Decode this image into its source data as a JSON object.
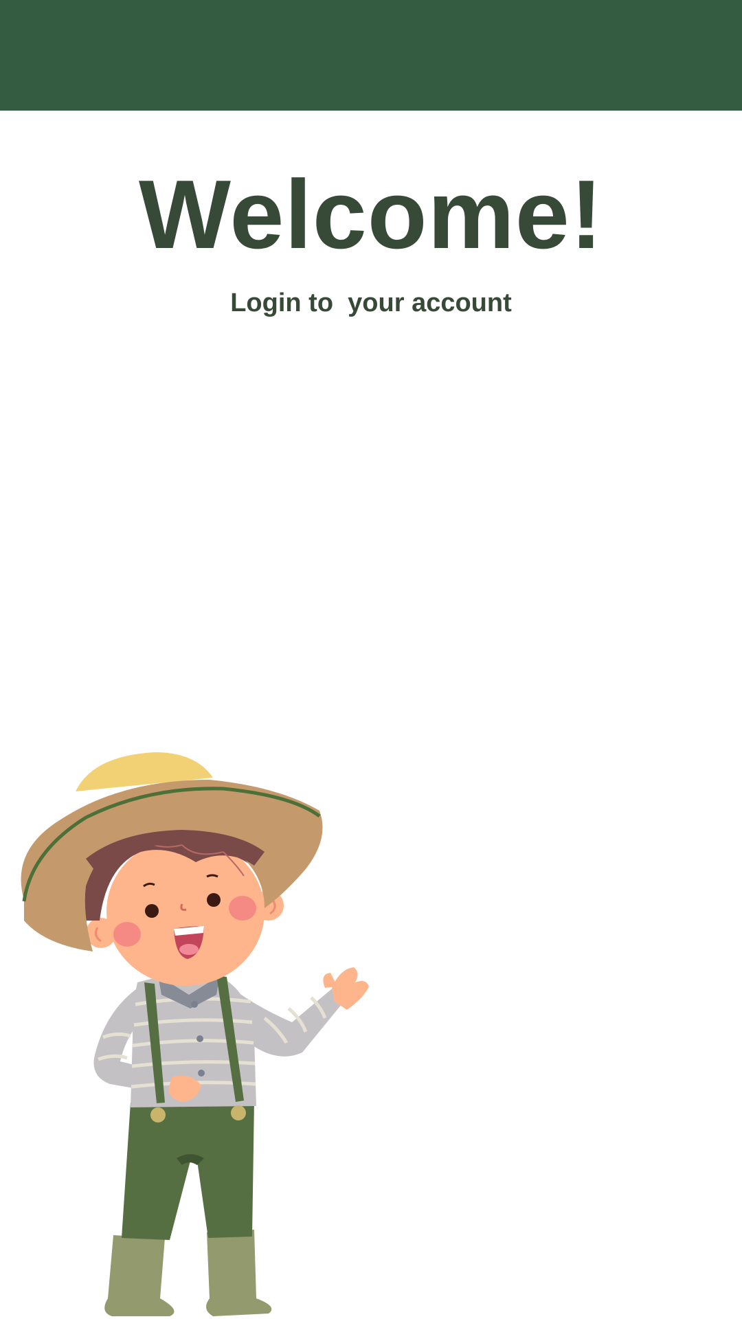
{
  "header": {
    "bar_color": "#345c41"
  },
  "main": {
    "title": "Welcome!",
    "subtitle": "Login to  your account",
    "text_color": "#364a37"
  },
  "illustration": {
    "icon": "farmer-boy-waving-illustration"
  }
}
